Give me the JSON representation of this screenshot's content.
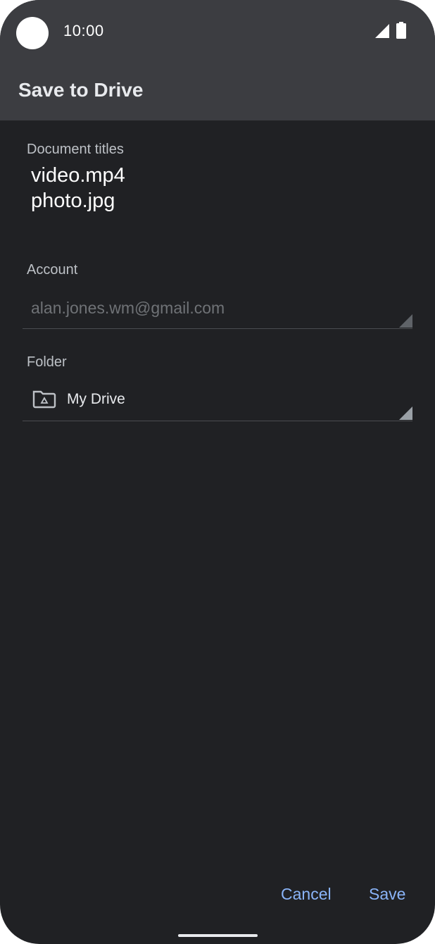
{
  "status_bar": {
    "time": "10:00"
  },
  "app_bar": {
    "title": "Save to Drive"
  },
  "document_titles": {
    "label": "Document titles",
    "items": [
      "video.mp4",
      "photo.jpg"
    ]
  },
  "account": {
    "label": "Account",
    "value": "alan.jones.wm@gmail.com"
  },
  "folder": {
    "label": "Folder",
    "value": "My Drive",
    "icon": "drive-folder-icon"
  },
  "actions": {
    "cancel": "Cancel",
    "save": "Save"
  },
  "colors": {
    "background": "#202124",
    "app_bar": "#3c3d41",
    "accent": "#8ab4f8"
  }
}
